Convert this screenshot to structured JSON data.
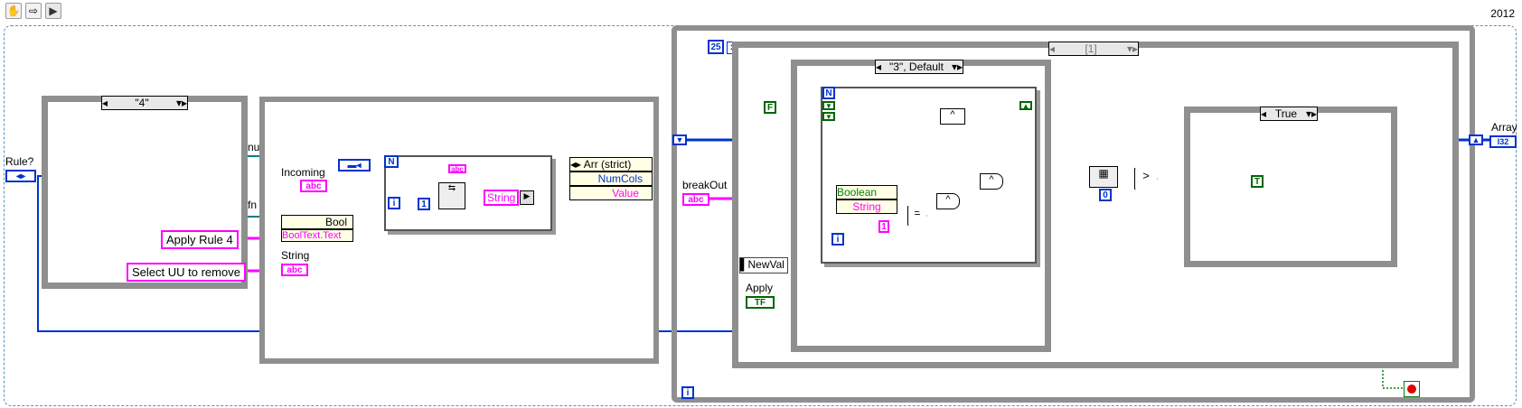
{
  "toolbar": {
    "icons": [
      "hand-icon",
      "arrow-right-icon",
      "run-arrow-icon"
    ]
  },
  "version_label": "2012",
  "controls": {
    "rule": "Rule?",
    "array": "Array",
    "array_type": "I32",
    "incoming": "Incoming",
    "string": "String",
    "breakout": "breakOut",
    "apply": "Apply",
    "newval": "NewVal",
    "tf": "TF",
    "num_truncated": "nu",
    "fn_truncated": "fn"
  },
  "constants": {
    "apply_rule": "Apply Rule 4",
    "select_uu": "Select UU to remove",
    "loop_count": "25",
    "false_const": "F",
    "true_const": "T",
    "zero": "0",
    "one": "1"
  },
  "case_structures": {
    "case1": "\"4\"",
    "case2": "\"3\", Default",
    "case3": "True",
    "seq_frame": "[1]"
  },
  "nodes": {
    "bool": "Bool",
    "booltext": "BoolText.Text",
    "arr_strict": "Arr (strict)",
    "numcols": "NumCols",
    "value": "Value",
    "boolean": "Boolean",
    "string_node": "String",
    "string_inner": "String",
    "and1": "^",
    "and2": "^",
    "and3": "^",
    "equal": "=",
    "greater": ">",
    "i_label": "i",
    "n_label": "N"
  },
  "colors": {
    "wire_blue": "#0033cc",
    "wire_pink": "#ff00ff",
    "wire_green": "#008000",
    "wire_teal": "#008080",
    "frame_gray": "#8f8f8f"
  }
}
